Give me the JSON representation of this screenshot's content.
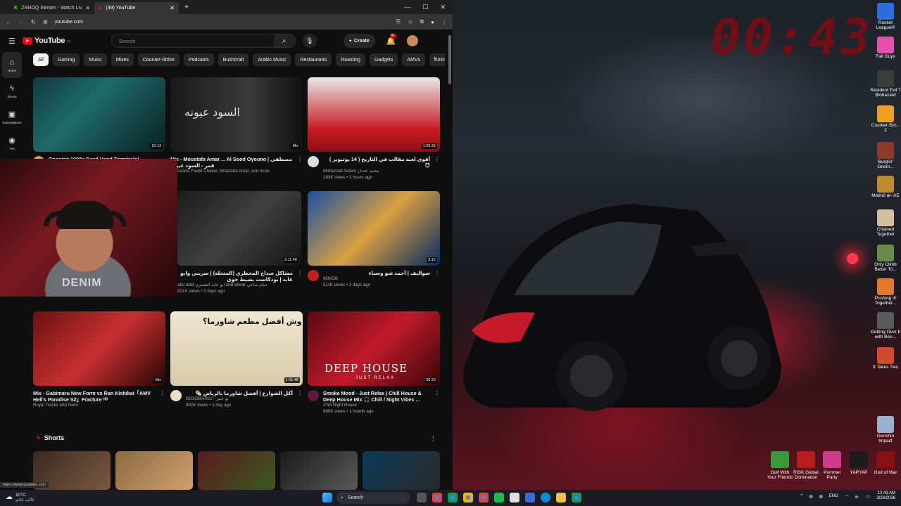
{
  "browser": {
    "tabs": [
      {
        "title": "ZRNOQ Stream - Watch Live o",
        "active": false
      },
      {
        "title": "(49) YouTube",
        "active": true
      }
    ],
    "url": "youtube.com",
    "status_url": "https://www.youtube.com"
  },
  "youtube": {
    "logo": "YouTube",
    "logo_country": "JO",
    "search_placeholder": "Search",
    "create_label": "Create",
    "notif_badge": "9+",
    "sidebar": [
      {
        "label": "Home",
        "icon": "home-icon"
      },
      {
        "label": "Shorts",
        "icon": "shorts-icon"
      },
      {
        "label": "Subscriptions",
        "icon": "subscriptions-icon"
      },
      {
        "label": "You",
        "icon": "you-icon"
      }
    ],
    "chips": [
      "All",
      "Gaming",
      "Music",
      "Mixes",
      "Counter-Strike",
      "Podcasts",
      "Bushcraft",
      "Arabic Music",
      "Restaurants",
      "Roasting",
      "Gadgets",
      "AMVs",
      "Anim"
    ],
    "videos": [
      {
        "title": "Opening 1000x Dead Hand Terminals!",
        "stats": "",
        "channel": "",
        "duration": "15:13"
      },
      {
        "title": "Mix - Moustafa Amar ... Al Sood Oyouno | مصطفى قمر - السود عيونه",
        "channel": "es Karam, Fadel Chaker, Moustafa Amar, and more",
        "stats": "",
        "duration": "Mix",
        "thumb_text": "السود عيونه"
      },
      {
        "title": "أقوى لعبة مقالب في التاريخ ( 14 يوتيوبر ) 😈",
        "channel": "Mohamad Adnan محمد عدنان",
        "stats": "183K views • 2 hours ago",
        "duration": "1:09:28"
      },
      {
        "title": "مشاكل سداح المحظري (المتحلة) | سريبي وابو عابد | بودكاست بسيط خوي",
        "channel": "abu abid ابو عابد الشمري and xBear جبام ساعي",
        "stats": "821K views • 2 days ago",
        "duration": "2:11:40"
      },
      {
        "title": "سواليف | أحمد شو وسناء",
        "channel": "M39OB",
        "stats": "511K views • 2 days ago",
        "duration": "3:15"
      },
      {
        "title": "Mix - Gabimaru New Form vs Ran Kishikai「AMV Hell's Paradise S2」Fracture ᴴᴰ",
        "channel": "Royal Tracks and more",
        "stats": "",
        "duration": "Mix"
      },
      {
        "title": "أكل الشوارع | أفضل شاورما بالرياض 🌯",
        "channel": "BO3OMAR22 - بو عمر",
        "stats": "992K views • 1 day ago",
        "duration": "1:01:48",
        "thumb_text": "وش أفضل مطعم شاورما؟"
      },
      {
        "title": "Smoke Mood - Just Relax | Chill House & Deep House Mix 🎧 Chill / Night Vibes ...",
        "channel": "Chill Night House",
        "stats": "689K views • 1 month ago",
        "duration": "30:25",
        "thumb_text": "DEEP HOUSE",
        "thumb_sub": "JUST RELAX"
      }
    ],
    "shorts_label": "Shorts",
    "webcam_shirt": "DENIM"
  },
  "desktop": {
    "clock": "00:43",
    "icons": [
      {
        "label": "Rocket League®",
        "color": "#2d6cdf"
      },
      {
        "label": "Fall Guys",
        "color": "#e64fb0"
      },
      {
        "label": "Resident Evil 7 Biohazard",
        "color": "#3b3b3b"
      },
      {
        "label": "Counter-Stri... 2",
        "color": "#f0a020"
      },
      {
        "label": "Burglin' Gnom...",
        "color": "#8a3a2a"
      },
      {
        "label": "Metin2 ar- AE",
        "color": "#c08a30"
      },
      {
        "label": "Chained Together",
        "color": "#d0c0a0"
      },
      {
        "label": "Only Climb Better To...",
        "color": "#6a8a4a"
      },
      {
        "label": "Pushing it! Together...",
        "color": "#e07a2a"
      },
      {
        "label": "Getting Over It with Ben...",
        "color": "#5a5a5a"
      },
      {
        "label": "It Takes Two",
        "color": "#d04a30"
      },
      {
        "label": "Genshin Impact",
        "color": "#9ab0d0"
      }
    ],
    "bottom_icons": [
      {
        "label": "Golf With Your Friends",
        "color": "#3a9a3a"
      },
      {
        "label": "RISK Global Domination",
        "color": "#b81c1c"
      },
      {
        "label": "Pummel Party",
        "color": "#d03a8a"
      },
      {
        "label": "YAPYAP",
        "color": "#1c1c1c"
      },
      {
        "label": "God of War",
        "color": "#8a1010"
      }
    ]
  },
  "taskbar": {
    "weather_temp": "10°C",
    "weather_desc": "غالب غائم",
    "search": "Search",
    "lang": "ENG",
    "time": "12:43 AM",
    "date": "3/28/2026"
  }
}
